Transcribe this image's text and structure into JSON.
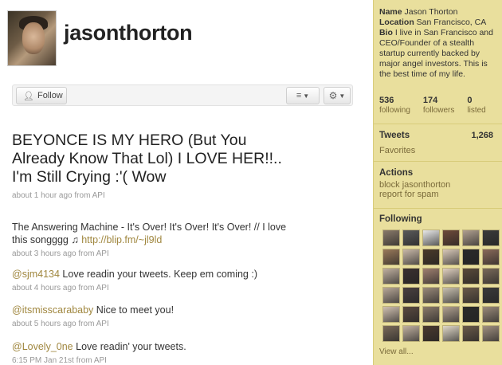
{
  "profile": {
    "username": "jasonthorton",
    "name_label": "Name",
    "name": "Jason Thorton",
    "location_label": "Location",
    "location": "San Francisco, CA",
    "bio_label": "Bio",
    "bio": "I live in San Francisco and CEO/Founder of a stealth startup currently backed by major angel investors. This is the best time of my life."
  },
  "actions_bar": {
    "follow_label": "Follow",
    "follow_icon": "person-plus-icon",
    "list_icon": "list-icon",
    "gear_icon": "gear-icon"
  },
  "stats": [
    {
      "num": "536",
      "label": "following"
    },
    {
      "num": "174",
      "label": "followers"
    },
    {
      "num": "0",
      "label": "listed"
    }
  ],
  "sidebar": {
    "tweets_label": "Tweets",
    "tweets_count": "1,268",
    "favorites_label": "Favorites",
    "actions_heading": "Actions",
    "block_label": "block jasonthorton",
    "report_label": "report for spam",
    "following_heading": "Following",
    "view_all_label": "View all..."
  },
  "tweets": [
    {
      "text": "BEYONCE IS MY HERO (But You Already Know That Lol) I LOVE HER!!.. I'm Still Crying :'( Wow",
      "meta": "about 1 hour ago from API"
    },
    {
      "text_before": "The Answering Machine - It's Over! It's Over! It's Over! // I love this songggg ♫ ",
      "link": "http://blip.fm/~jl9ld",
      "meta": "about 3 hours ago from API"
    },
    {
      "mention": "@sjm4134",
      "text": " Love readin your tweets. Keep em coming :)",
      "meta": "about 4 hours ago from API"
    },
    {
      "mention": "@itsmisscarababy",
      "text": " Nice to meet you!",
      "meta": "about 5 hours ago from API"
    },
    {
      "mention": "@Lovely_0ne",
      "text": " Love readin' your tweets.",
      "meta": "6:15 PM Jan 21st from API"
    }
  ],
  "colors": {
    "sidebar_bg": "#e9df9d",
    "link": "#a0873f",
    "sidebar_link": "#7a6a3a"
  },
  "following_thumbs": [
    "#8a7a6a",
    "#5a5a5a",
    "#e8e8e8",
    "#6e4a3a",
    "#b0a090",
    "#3a3a3a",
    "#9a7a5a",
    "#c8b8a8",
    "#4a3a2a",
    "#d8c8b8",
    "#2a2a2a",
    "#8a6a5a",
    "#c0b0a0",
    "#3a3030",
    "#a08070",
    "#e0d0c0",
    "#5a4a3a",
    "#7a6a5a",
    "#b8a898",
    "#4a4040",
    "#9a8a7a",
    "#c8c0b0",
    "#6a5a4a",
    "#3a3a3a",
    "#d0c0b0",
    "#5a4a40",
    "#8a7a6a",
    "#b0a090",
    "#2a2a2a",
    "#9a8a7a",
    "#7a6a5a",
    "#c0b0a0",
    "#4a3a30",
    "#e0d8c8",
    "#6a5a4a",
    "#a09080"
  ]
}
